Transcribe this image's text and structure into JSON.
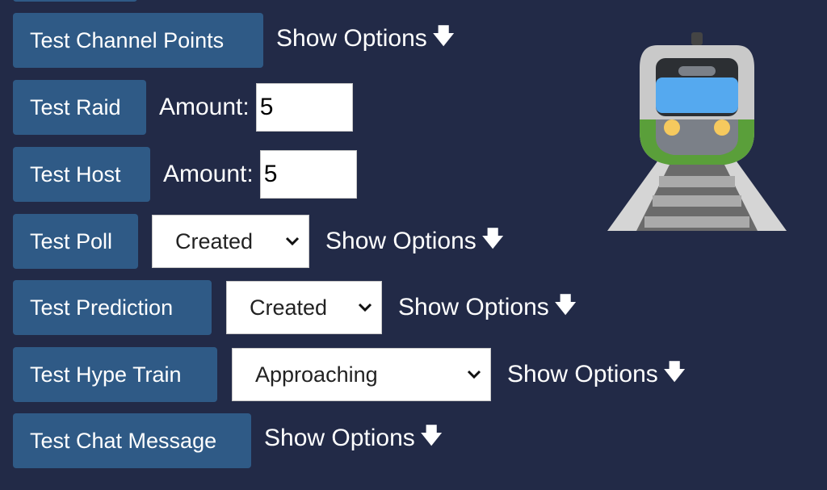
{
  "buttons": {
    "channel_points": "Test Channel Points",
    "raid": "Test Raid",
    "host": "Test Host",
    "poll": "Test Poll",
    "prediction": "Test Prediction",
    "hype_train": "Test Hype Train",
    "chat_message": "Test Chat Message"
  },
  "show_options_label": "Show Options",
  "raid": {
    "amount_label": "Amount:",
    "amount_value": "5"
  },
  "host": {
    "amount_label": "Amount:",
    "amount_value": "5"
  },
  "poll": {
    "selected": "Created"
  },
  "prediction": {
    "selected": "Created"
  },
  "hype_train": {
    "selected": "Approaching"
  },
  "icons": {
    "show_options_arrow": "down-arrow-icon",
    "select_chevron": "chevron-down-icon",
    "decorative_image": "train-icon"
  },
  "colors": {
    "background": "#222a47",
    "button": "#2f5a86",
    "text": "#ffffff"
  }
}
